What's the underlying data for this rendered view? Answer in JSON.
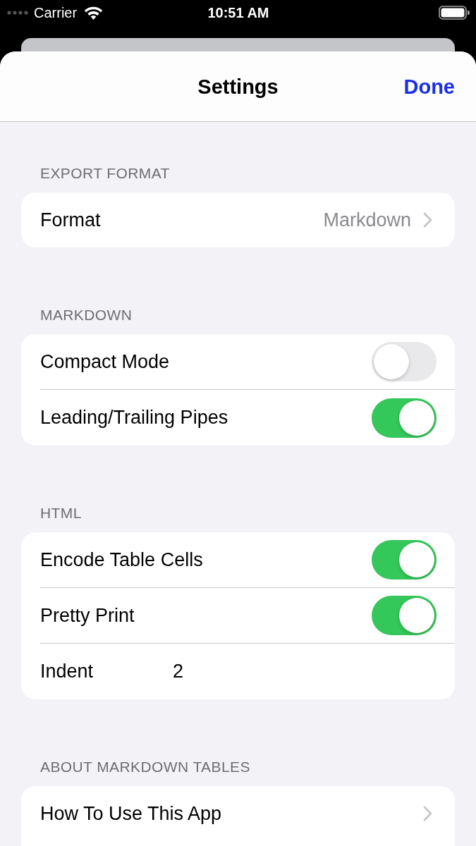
{
  "status_bar": {
    "carrier": "Carrier",
    "time": "10:51 AM"
  },
  "nav_bar": {
    "title": "Settings",
    "done_button": "Done"
  },
  "sections": [
    {
      "header": "EXPORT FORMAT",
      "rows": [
        {
          "kind": "disclosure",
          "label": "Format",
          "value": "Markdown"
        }
      ]
    },
    {
      "header": "MARKDOWN",
      "rows": [
        {
          "kind": "toggle",
          "label": "Compact Mode",
          "on": false
        },
        {
          "kind": "toggle",
          "label": "Leading/Trailing Pipes",
          "on": true
        }
      ]
    },
    {
      "header": "HTML",
      "rows": [
        {
          "kind": "toggle",
          "label": "Encode Table Cells",
          "on": true
        },
        {
          "kind": "toggle",
          "label": "Pretty Print",
          "on": true
        },
        {
          "kind": "field",
          "label": "Indent",
          "value": "2"
        }
      ]
    },
    {
      "header": "ABOUT MARKDOWN TABLES",
      "rows": [
        {
          "kind": "disclosure",
          "label": "How To Use This App"
        }
      ]
    }
  ]
}
